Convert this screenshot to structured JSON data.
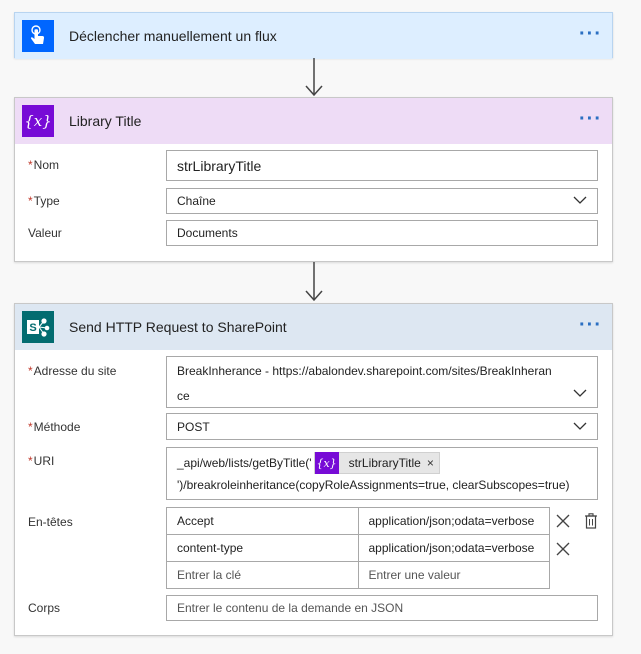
{
  "trigger": {
    "title": "Déclencher manuellement un flux",
    "more": "···"
  },
  "variable_card": {
    "title": "Library Title",
    "more": "···",
    "fields": {
      "name": {
        "label": "Nom",
        "required": "*",
        "value": "strLibraryTitle"
      },
      "type": {
        "label": "Type",
        "required": "*",
        "value": "Chaîne"
      },
      "value": {
        "label": "Valeur",
        "value": "Documents"
      }
    }
  },
  "http_card": {
    "title": "Send HTTP Request to SharePoint",
    "more": "···",
    "fields": {
      "site": {
        "label": "Adresse du site",
        "required": "*",
        "value_line1": "BreakInherance - https://abalondev.sharepoint.com/sites/BreakInheran",
        "value_line2": "ce"
      },
      "method": {
        "label": "Méthode",
        "required": "*",
        "value": "POST"
      },
      "uri": {
        "label": "URI",
        "required": "*",
        "prefix": "_api/web/lists/getByTitle('",
        "token_icon": "{x}",
        "token": "strLibraryTitle",
        "token_remove": "×",
        "suffix": "')/breakroleinheritance(copyRoleAssignments=true, clearSubscopes=true)"
      },
      "headers": {
        "label": "En-têtes",
        "rows": [
          {
            "key": "Accept",
            "value": "application/json;odata=verbose"
          },
          {
            "key": "content-type",
            "value": "application/json;odata=verbose"
          }
        ],
        "key_placeholder": "Entrer la clé",
        "value_placeholder": "Entrer une valeur"
      },
      "body": {
        "label": "Corps",
        "placeholder": "Entrer le contenu de la demande en JSON"
      }
    }
  },
  "colors": {
    "trigger_accent": "#0066ff",
    "trigger_bg": "#ddeeff",
    "variable_accent": "#770bd6",
    "variable_bg": "#eedcf6",
    "sharepoint_accent": "#036c70",
    "sharepoint_bg": "#dde7f2",
    "link_blue": "#2b6fc2"
  }
}
